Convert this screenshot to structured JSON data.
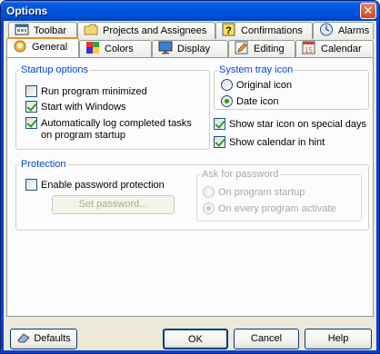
{
  "window": {
    "title": "Options",
    "close_glyph": "✕"
  },
  "tabs_row1": [
    {
      "label": "Toolbar",
      "icon": "toolbar-icon"
    },
    {
      "label": "Projects and Assignees",
      "icon": "folder-icon"
    },
    {
      "label": "Confirmations",
      "icon": "question-icon"
    },
    {
      "label": "Alarms",
      "icon": "clock-icon"
    }
  ],
  "tabs_row2": [
    {
      "label": "General",
      "icon": "general-icon",
      "active": true
    },
    {
      "label": "Colors",
      "icon": "colors-icon"
    },
    {
      "label": "Display",
      "icon": "monitor-icon"
    },
    {
      "label": "Editing",
      "icon": "pencil-icon"
    },
    {
      "label": "Calendar",
      "icon": "calendar-icon"
    }
  ],
  "calendar_icon_text": "15",
  "startup": {
    "title": "Startup options",
    "run_minimized": {
      "label": "Run program minimized",
      "checked": false
    },
    "start_with_windows": {
      "label": "Start with Windows",
      "checked": true
    },
    "auto_log_line1": "Automatically log completed tasks",
    "auto_log_line2": "on program startup",
    "auto_log_checked": true
  },
  "tray": {
    "title": "System tray icon",
    "original": {
      "label": "Original icon",
      "selected": false
    },
    "date": {
      "label": "Date icon",
      "selected": true
    }
  },
  "star_icon": {
    "label": "Show star icon on special days",
    "checked": true
  },
  "show_calendar": {
    "label": "Show calendar in hint",
    "checked": true
  },
  "protection": {
    "title": "Protection",
    "enable": {
      "label": "Enable password protection",
      "checked": false
    },
    "set_password_button": "Set password...",
    "ask": {
      "title": "Ask for password",
      "on_startup": {
        "label": "On program startup",
        "selected": false
      },
      "on_activate": {
        "label": "On every program activate",
        "selected": true
      }
    }
  },
  "buttons": {
    "defaults": "Defaults",
    "ok": "OK",
    "cancel": "Cancel",
    "help": "Help"
  },
  "colors": {
    "title_bar": "#0054e3",
    "face": "#ece9d8",
    "group_label": "#0046d5",
    "check": "#21a121",
    "active_tab_accent": "#e68b2c"
  }
}
